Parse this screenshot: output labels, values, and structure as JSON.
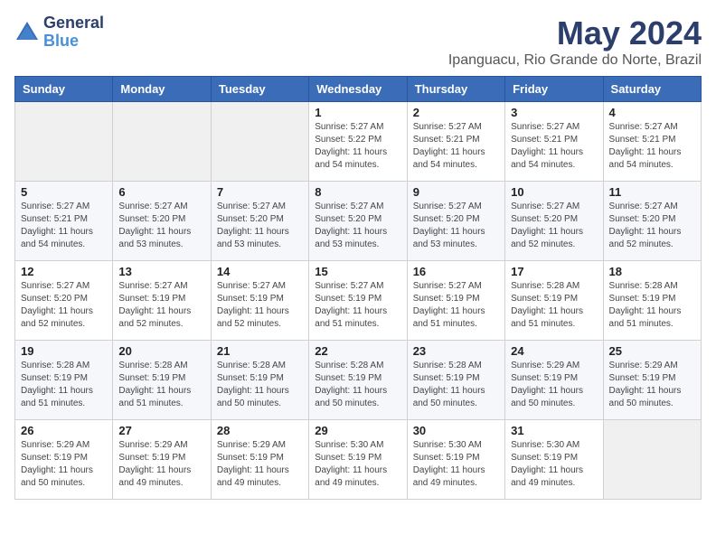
{
  "logo": {
    "general": "General",
    "blue": "Blue"
  },
  "title": "May 2024",
  "location": "Ipanguacu, Rio Grande do Norte, Brazil",
  "days_of_week": [
    "Sunday",
    "Monday",
    "Tuesday",
    "Wednesday",
    "Thursday",
    "Friday",
    "Saturday"
  ],
  "weeks": [
    [
      {
        "num": "",
        "sunrise": "",
        "sunset": "",
        "daylight": ""
      },
      {
        "num": "",
        "sunrise": "",
        "sunset": "",
        "daylight": ""
      },
      {
        "num": "",
        "sunrise": "",
        "sunset": "",
        "daylight": ""
      },
      {
        "num": "1",
        "sunrise": "Sunrise: 5:27 AM",
        "sunset": "Sunset: 5:22 PM",
        "daylight": "Daylight: 11 hours and 54 minutes."
      },
      {
        "num": "2",
        "sunrise": "Sunrise: 5:27 AM",
        "sunset": "Sunset: 5:21 PM",
        "daylight": "Daylight: 11 hours and 54 minutes."
      },
      {
        "num": "3",
        "sunrise": "Sunrise: 5:27 AM",
        "sunset": "Sunset: 5:21 PM",
        "daylight": "Daylight: 11 hours and 54 minutes."
      },
      {
        "num": "4",
        "sunrise": "Sunrise: 5:27 AM",
        "sunset": "Sunset: 5:21 PM",
        "daylight": "Daylight: 11 hours and 54 minutes."
      }
    ],
    [
      {
        "num": "5",
        "sunrise": "Sunrise: 5:27 AM",
        "sunset": "Sunset: 5:21 PM",
        "daylight": "Daylight: 11 hours and 54 minutes."
      },
      {
        "num": "6",
        "sunrise": "Sunrise: 5:27 AM",
        "sunset": "Sunset: 5:20 PM",
        "daylight": "Daylight: 11 hours and 53 minutes."
      },
      {
        "num": "7",
        "sunrise": "Sunrise: 5:27 AM",
        "sunset": "Sunset: 5:20 PM",
        "daylight": "Daylight: 11 hours and 53 minutes."
      },
      {
        "num": "8",
        "sunrise": "Sunrise: 5:27 AM",
        "sunset": "Sunset: 5:20 PM",
        "daylight": "Daylight: 11 hours and 53 minutes."
      },
      {
        "num": "9",
        "sunrise": "Sunrise: 5:27 AM",
        "sunset": "Sunset: 5:20 PM",
        "daylight": "Daylight: 11 hours and 53 minutes."
      },
      {
        "num": "10",
        "sunrise": "Sunrise: 5:27 AM",
        "sunset": "Sunset: 5:20 PM",
        "daylight": "Daylight: 11 hours and 52 minutes."
      },
      {
        "num": "11",
        "sunrise": "Sunrise: 5:27 AM",
        "sunset": "Sunset: 5:20 PM",
        "daylight": "Daylight: 11 hours and 52 minutes."
      }
    ],
    [
      {
        "num": "12",
        "sunrise": "Sunrise: 5:27 AM",
        "sunset": "Sunset: 5:20 PM",
        "daylight": "Daylight: 11 hours and 52 minutes."
      },
      {
        "num": "13",
        "sunrise": "Sunrise: 5:27 AM",
        "sunset": "Sunset: 5:19 PM",
        "daylight": "Daylight: 11 hours and 52 minutes."
      },
      {
        "num": "14",
        "sunrise": "Sunrise: 5:27 AM",
        "sunset": "Sunset: 5:19 PM",
        "daylight": "Daylight: 11 hours and 52 minutes."
      },
      {
        "num": "15",
        "sunrise": "Sunrise: 5:27 AM",
        "sunset": "Sunset: 5:19 PM",
        "daylight": "Daylight: 11 hours and 51 minutes."
      },
      {
        "num": "16",
        "sunrise": "Sunrise: 5:27 AM",
        "sunset": "Sunset: 5:19 PM",
        "daylight": "Daylight: 11 hours and 51 minutes."
      },
      {
        "num": "17",
        "sunrise": "Sunrise: 5:28 AM",
        "sunset": "Sunset: 5:19 PM",
        "daylight": "Daylight: 11 hours and 51 minutes."
      },
      {
        "num": "18",
        "sunrise": "Sunrise: 5:28 AM",
        "sunset": "Sunset: 5:19 PM",
        "daylight": "Daylight: 11 hours and 51 minutes."
      }
    ],
    [
      {
        "num": "19",
        "sunrise": "Sunrise: 5:28 AM",
        "sunset": "Sunset: 5:19 PM",
        "daylight": "Daylight: 11 hours and 51 minutes."
      },
      {
        "num": "20",
        "sunrise": "Sunrise: 5:28 AM",
        "sunset": "Sunset: 5:19 PM",
        "daylight": "Daylight: 11 hours and 51 minutes."
      },
      {
        "num": "21",
        "sunrise": "Sunrise: 5:28 AM",
        "sunset": "Sunset: 5:19 PM",
        "daylight": "Daylight: 11 hours and 50 minutes."
      },
      {
        "num": "22",
        "sunrise": "Sunrise: 5:28 AM",
        "sunset": "Sunset: 5:19 PM",
        "daylight": "Daylight: 11 hours and 50 minutes."
      },
      {
        "num": "23",
        "sunrise": "Sunrise: 5:28 AM",
        "sunset": "Sunset: 5:19 PM",
        "daylight": "Daylight: 11 hours and 50 minutes."
      },
      {
        "num": "24",
        "sunrise": "Sunrise: 5:29 AM",
        "sunset": "Sunset: 5:19 PM",
        "daylight": "Daylight: 11 hours and 50 minutes."
      },
      {
        "num": "25",
        "sunrise": "Sunrise: 5:29 AM",
        "sunset": "Sunset: 5:19 PM",
        "daylight": "Daylight: 11 hours and 50 minutes."
      }
    ],
    [
      {
        "num": "26",
        "sunrise": "Sunrise: 5:29 AM",
        "sunset": "Sunset: 5:19 PM",
        "daylight": "Daylight: 11 hours and 50 minutes."
      },
      {
        "num": "27",
        "sunrise": "Sunrise: 5:29 AM",
        "sunset": "Sunset: 5:19 PM",
        "daylight": "Daylight: 11 hours and 49 minutes."
      },
      {
        "num": "28",
        "sunrise": "Sunrise: 5:29 AM",
        "sunset": "Sunset: 5:19 PM",
        "daylight": "Daylight: 11 hours and 49 minutes."
      },
      {
        "num": "29",
        "sunrise": "Sunrise: 5:30 AM",
        "sunset": "Sunset: 5:19 PM",
        "daylight": "Daylight: 11 hours and 49 minutes."
      },
      {
        "num": "30",
        "sunrise": "Sunrise: 5:30 AM",
        "sunset": "Sunset: 5:19 PM",
        "daylight": "Daylight: 11 hours and 49 minutes."
      },
      {
        "num": "31",
        "sunrise": "Sunrise: 5:30 AM",
        "sunset": "Sunset: 5:19 PM",
        "daylight": "Daylight: 11 hours and 49 minutes."
      },
      {
        "num": "",
        "sunrise": "",
        "sunset": "",
        "daylight": ""
      }
    ]
  ]
}
